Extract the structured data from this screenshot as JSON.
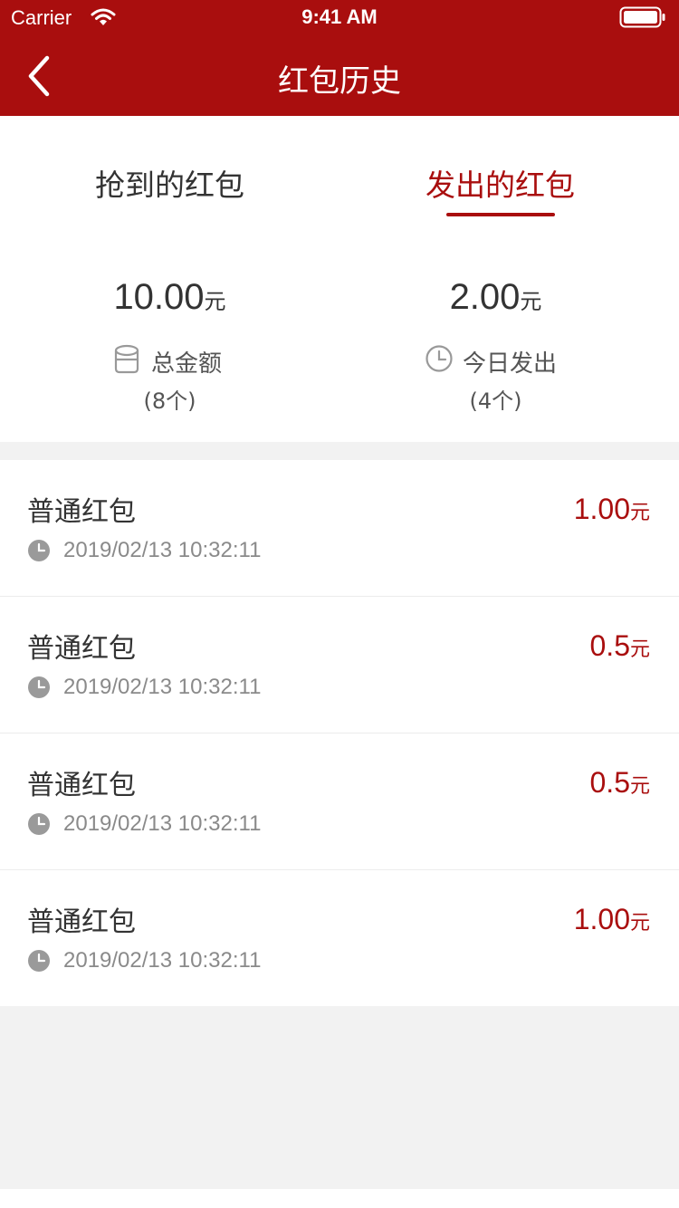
{
  "status_bar": {
    "carrier": "Carrier",
    "time": "9:41 AM"
  },
  "nav": {
    "title": "红包历史"
  },
  "tabs": [
    {
      "label": "抢到的红包",
      "active": false
    },
    {
      "label": "发出的红包",
      "active": true
    }
  ],
  "summary": {
    "total": {
      "amount": "10.00",
      "unit": "元",
      "label": "总金额",
      "count": "(8个)"
    },
    "today": {
      "amount": "2.00",
      "unit": "元",
      "label": "今日发出",
      "count": "(4个)"
    }
  },
  "records": [
    {
      "title": "普通红包",
      "time": "2019/02/13 10:32:11",
      "amount": "1.00",
      "unit": "元"
    },
    {
      "title": "普通红包",
      "time": "2019/02/13 10:32:11",
      "amount": "0.5",
      "unit": "元"
    },
    {
      "title": "普通红包",
      "time": "2019/02/13 10:32:11",
      "amount": "0.5",
      "unit": "元"
    },
    {
      "title": "普通红包",
      "time": "2019/02/13 10:32:11",
      "amount": "1.00",
      "unit": "元"
    }
  ],
  "colors": {
    "brand_red": "#a90e0e",
    "background": "#f2f2f2"
  },
  "icons": [
    "wifi-icon",
    "battery-icon",
    "back-icon",
    "wallet-icon",
    "clock-icon"
  ]
}
